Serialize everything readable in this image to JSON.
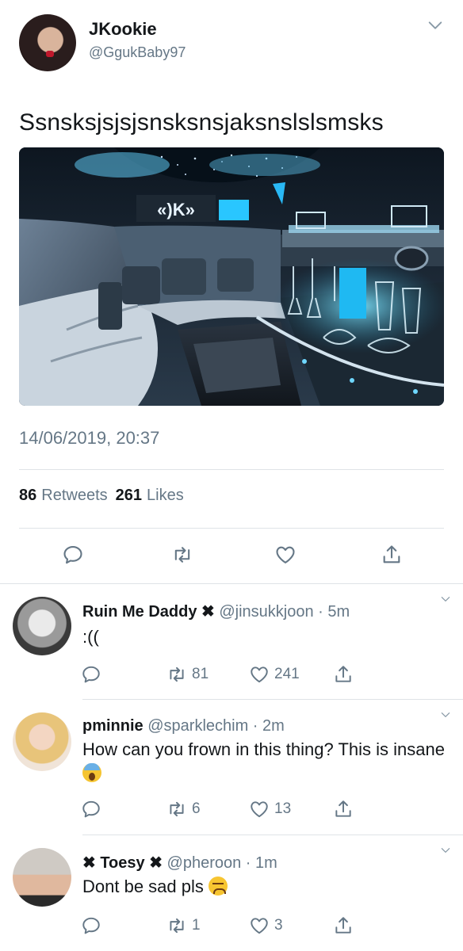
{
  "tweet": {
    "display_name": "JKookie",
    "handle": "@GgukBaby97",
    "text": "Ssnsksjsjsjsnsksnsjaksnslslsmsks",
    "image_sign_text": "«)K»",
    "timestamp": "14/06/2019, 20:37",
    "retweets_count": "86",
    "retweets_label": "Retweets",
    "likes_count": "261",
    "likes_label": "Likes"
  },
  "replies": [
    {
      "name": "Ruin Me Daddy",
      "name_suffix": "✖",
      "name_prefix": "",
      "handle": "@jinsukkjoon",
      "time": "5m",
      "text": ":((",
      "retweets": "81",
      "likes": "241"
    },
    {
      "name": "pminnie",
      "name_suffix": "",
      "name_prefix": "",
      "handle": "@sparklechim",
      "time": "2m",
      "text": "How can you frown in this thing? This is insane",
      "retweets": "6",
      "likes": "13"
    },
    {
      "name": "Toesy",
      "name_suffix": "✖",
      "name_prefix": "✖",
      "handle": "@pheroon",
      "time": "1m",
      "text": "Dont be sad pls",
      "retweets": "1",
      "likes": "3"
    }
  ],
  "colors": {
    "text_primary": "#14171a",
    "text_secondary": "#657786",
    "divider": "#dfe3e7"
  },
  "icons": [
    "chevron-down-icon",
    "reply-icon",
    "retweet-icon",
    "like-icon",
    "share-icon"
  ]
}
